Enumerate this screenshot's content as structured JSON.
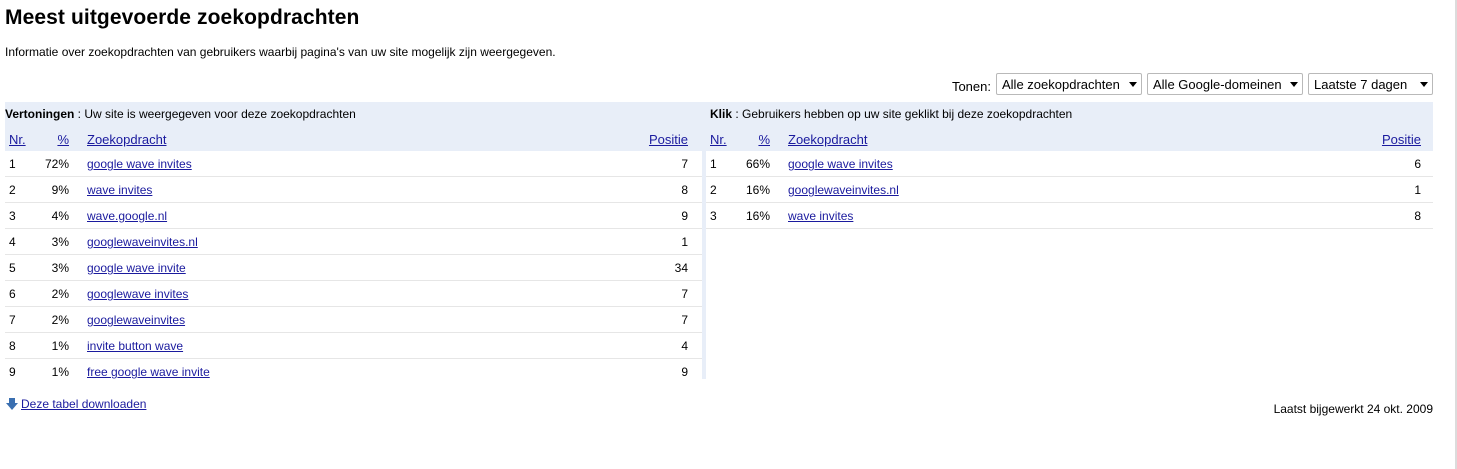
{
  "page": {
    "title": "Meest uitgevoerde zoekopdrachten",
    "subtitle": "Informatie over zoekopdrachten van gebruikers waarbij pagina's van uw site mogelijk zijn weergegeven."
  },
  "filters": {
    "label": "Tonen:",
    "query_type": "Alle zoekopdrachten",
    "domain": "Alle Google-domeinen",
    "period": "Laatste 7 dagen"
  },
  "columns": {
    "nr": "Nr.",
    "pct": "%",
    "query": "Zoekopdracht",
    "position": "Positie"
  },
  "impressions": {
    "title_bold": "Vertoningen",
    "title_rest": " : Uw site is weergegeven voor deze zoekopdrachten",
    "rows": [
      {
        "nr": "1",
        "pct": "72%",
        "query": "google wave invites",
        "position": "7"
      },
      {
        "nr": "2",
        "pct": "9%",
        "query": "wave invites",
        "position": "8"
      },
      {
        "nr": "3",
        "pct": "4%",
        "query": "wave.google.nl",
        "position": "9"
      },
      {
        "nr": "4",
        "pct": "3%",
        "query": "googlewaveinvites.nl",
        "position": "1"
      },
      {
        "nr": "5",
        "pct": "3%",
        "query": "google wave invite",
        "position": "34"
      },
      {
        "nr": "6",
        "pct": "2%",
        "query": "googlewave invites",
        "position": "7"
      },
      {
        "nr": "7",
        "pct": "2%",
        "query": "googlewaveinvites",
        "position": "7"
      },
      {
        "nr": "8",
        "pct": "1%",
        "query": "invite button wave",
        "position": "4"
      },
      {
        "nr": "9",
        "pct": "1%",
        "query": "free google wave invite",
        "position": "9"
      }
    ]
  },
  "clicks": {
    "title_bold": "Klik",
    "title_rest": " : Gebruikers hebben op uw site geklikt bij deze zoekopdrachten",
    "rows": [
      {
        "nr": "1",
        "pct": "66%",
        "query": "google wave invites",
        "position": "6"
      },
      {
        "nr": "2",
        "pct": "16%",
        "query": "googlewaveinvites.nl",
        "position": "1"
      },
      {
        "nr": "3",
        "pct": "16%",
        "query": "wave invites",
        "position": "8"
      }
    ]
  },
  "footer": {
    "download_label": "Deze tabel downloaden",
    "updated": "Laatst bijgewerkt 24 okt. 2009"
  },
  "colors": {
    "header_bg": "#e8eef8",
    "link": "#1a1a9e"
  },
  "icons": {
    "download": "download-arrow-icon",
    "dropdown": "chevron-down-icon"
  }
}
